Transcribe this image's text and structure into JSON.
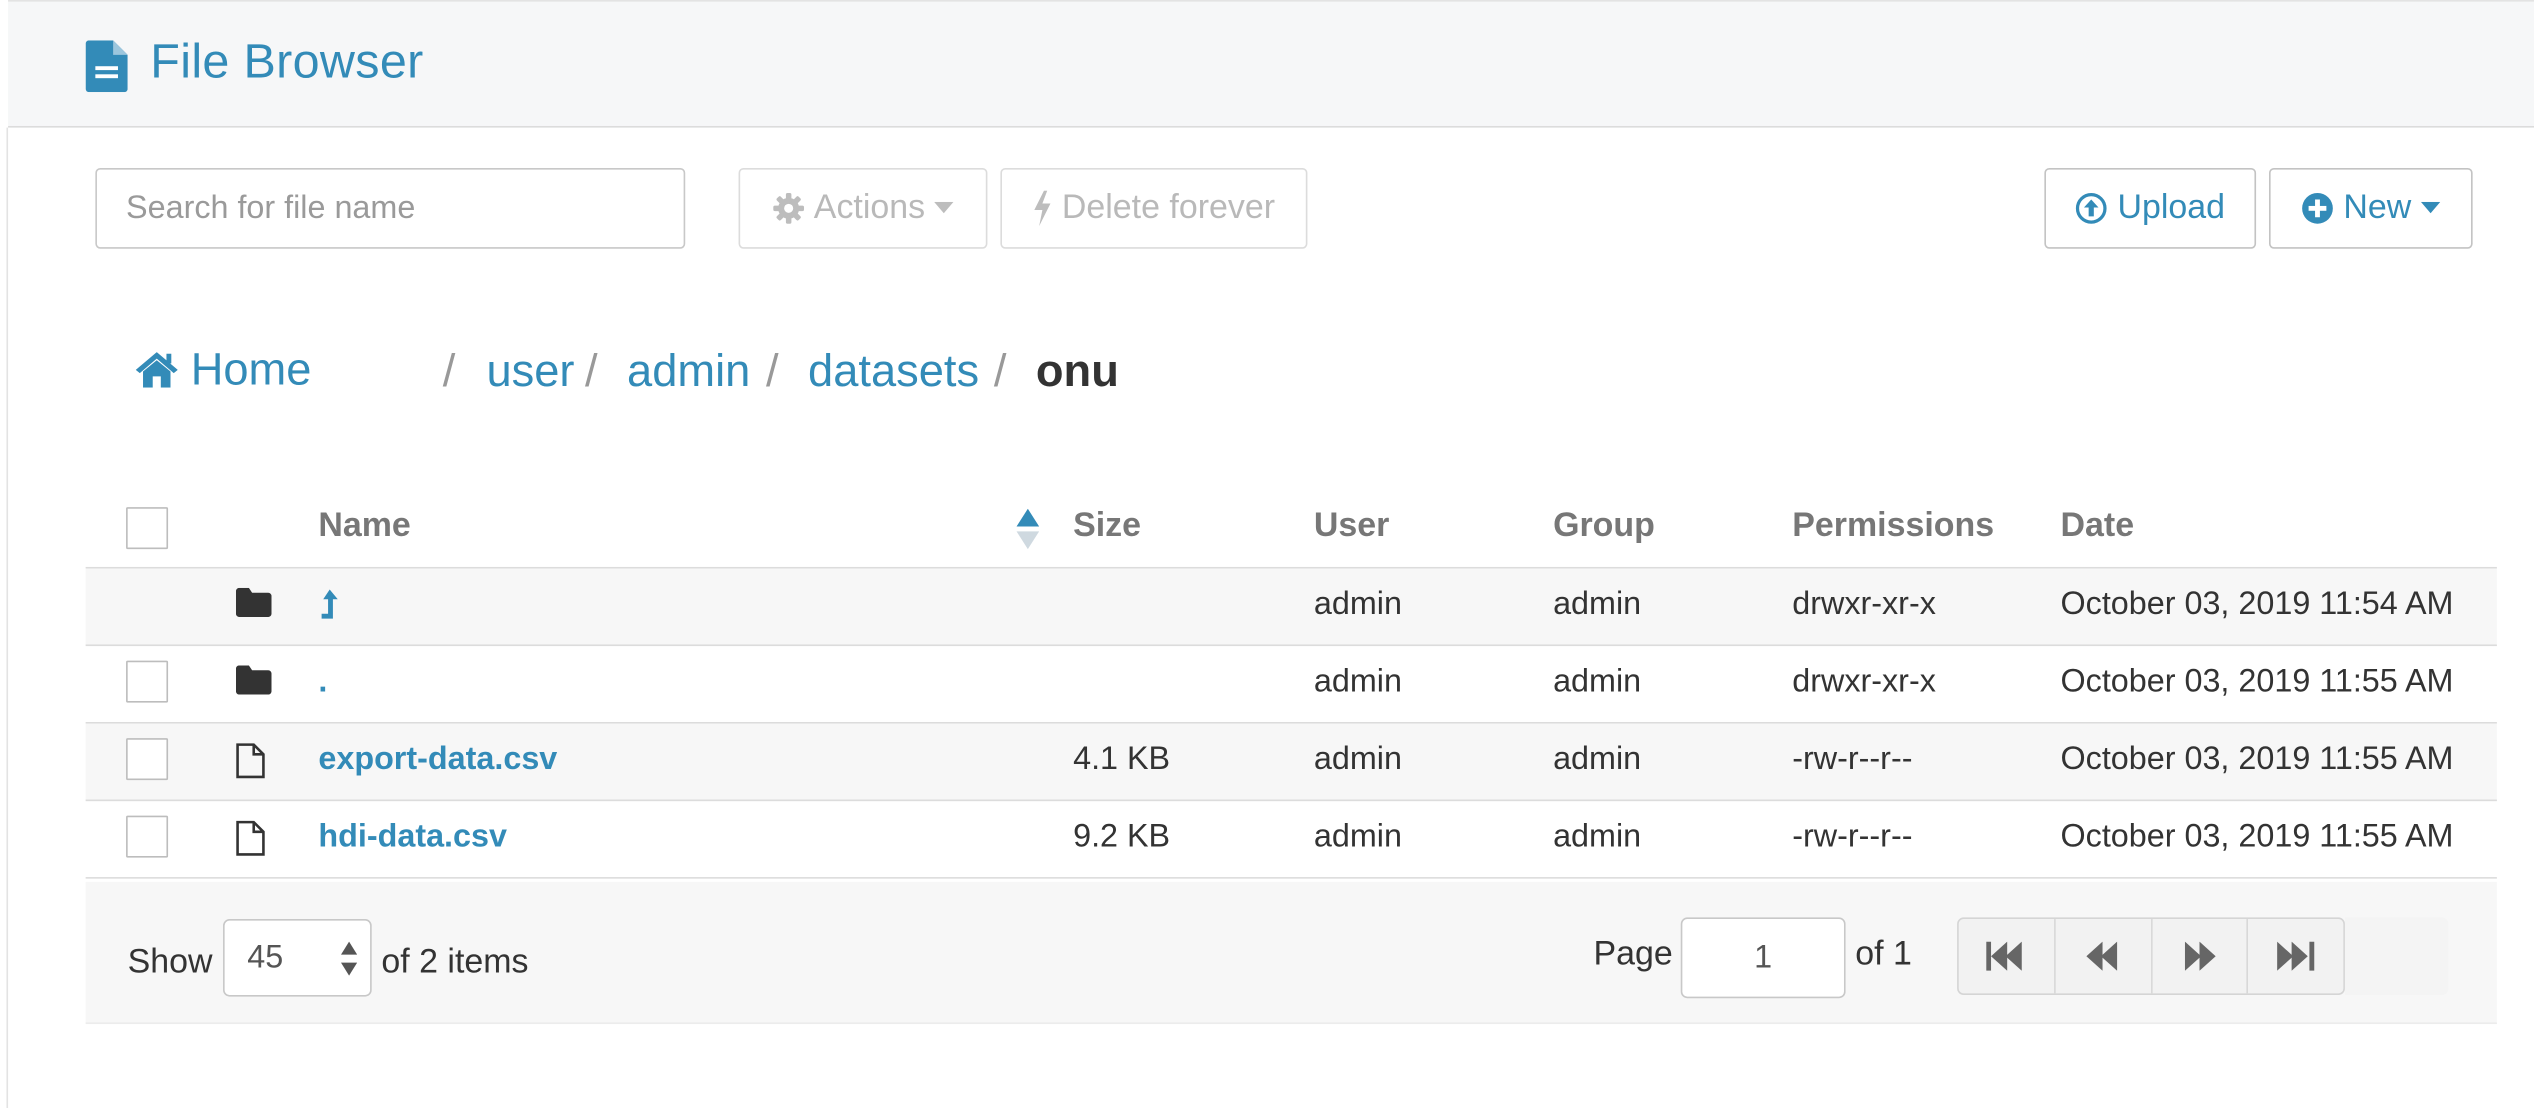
{
  "header": {
    "title": "File Browser",
    "icon": "file-document-icon"
  },
  "toolbar": {
    "search_placeholder": "Search for file name",
    "actions_label": "Actions",
    "delete_label": "Delete forever",
    "upload_label": "Upload",
    "new_label": "New"
  },
  "breadcrumb": {
    "home": "Home",
    "items": [
      "user",
      "admin",
      "datasets"
    ],
    "current": "onu",
    "separator": "/"
  },
  "table": {
    "columns": {
      "name": "Name",
      "size": "Size",
      "user": "User",
      "group": "Group",
      "permissions": "Permissions",
      "date": "Date"
    },
    "rows": [
      {
        "name": "",
        "icon": "parent-directory-icon",
        "type": "folder",
        "size": "",
        "user": "admin",
        "group": "admin",
        "permissions": "drwxr-xr-x",
        "date": "October 03, 2019 11:54 AM"
      },
      {
        "name": ".",
        "type": "folder",
        "size": "",
        "user": "admin",
        "group": "admin",
        "permissions": "drwxr-xr-x",
        "date": "October 03, 2019 11:55 AM"
      },
      {
        "name": "export-data.csv",
        "type": "file",
        "size": "4.1 KB",
        "user": "admin",
        "group": "admin",
        "permissions": "-rw-r--r--",
        "date": "October 03, 2019 11:55 AM"
      },
      {
        "name": "hdi-data.csv",
        "type": "file",
        "size": "9.2 KB",
        "user": "admin",
        "group": "admin",
        "permissions": "-rw-r--r--",
        "date": "October 03, 2019 11:55 AM"
      }
    ]
  },
  "footer": {
    "show_label": "Show",
    "page_size": "45",
    "items_label": "of 2 items",
    "page_label": "Page",
    "page_value": "1",
    "of_pages": "of 1"
  },
  "colors": {
    "accent": "#338bb8",
    "text": "#333333",
    "muted": "#777777",
    "row_shade": "#f7f7f7"
  }
}
